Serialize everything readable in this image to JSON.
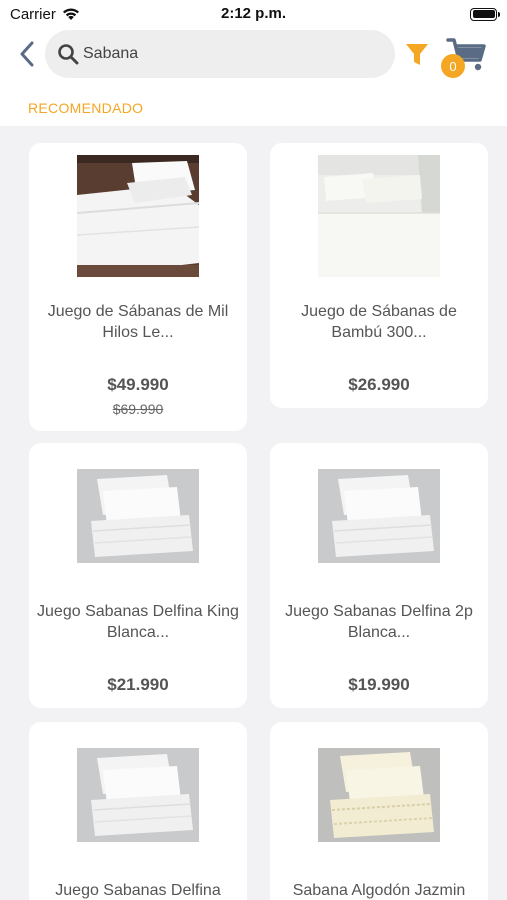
{
  "status": {
    "carrier": "Carrier",
    "time": "2:12 p.m."
  },
  "nav": {
    "search_value": "Sabana",
    "cart_count": "0"
  },
  "section": {
    "label": "RECOMENDADO"
  },
  "products": [
    {
      "title": "Juego de Sábanas de Mil Hilos Le...",
      "price": "$49.990",
      "old_price": "$69.990",
      "image": "white-sheets-bed-photo"
    },
    {
      "title": "Juego de Sábanas de Bambú 300...",
      "price": "$26.990",
      "old_price": "",
      "image": "bamboo-sheets-bed-photo"
    },
    {
      "title": "Juego Sabanas Delfina King Blanca...",
      "price": "$21.990",
      "old_price": "",
      "image": "folded-white-sheets-photo"
    },
    {
      "title": "Juego Sabanas Delfina 2p Blanca...",
      "price": "$19.990",
      "old_price": "",
      "image": "folded-white-sheets-photo"
    },
    {
      "title": "Juego Sabanas Delfina",
      "price": "",
      "old_price": "",
      "image": "folded-white-sheets-photo"
    },
    {
      "title": "Sabana Algodón Jazmin",
      "price": "",
      "old_price": "",
      "image": "cream-sheets-lace-photo"
    }
  ],
  "colors": {
    "accent": "#f5a623",
    "nav_icon": "#5a6b85",
    "background": "#f2f2f4"
  }
}
